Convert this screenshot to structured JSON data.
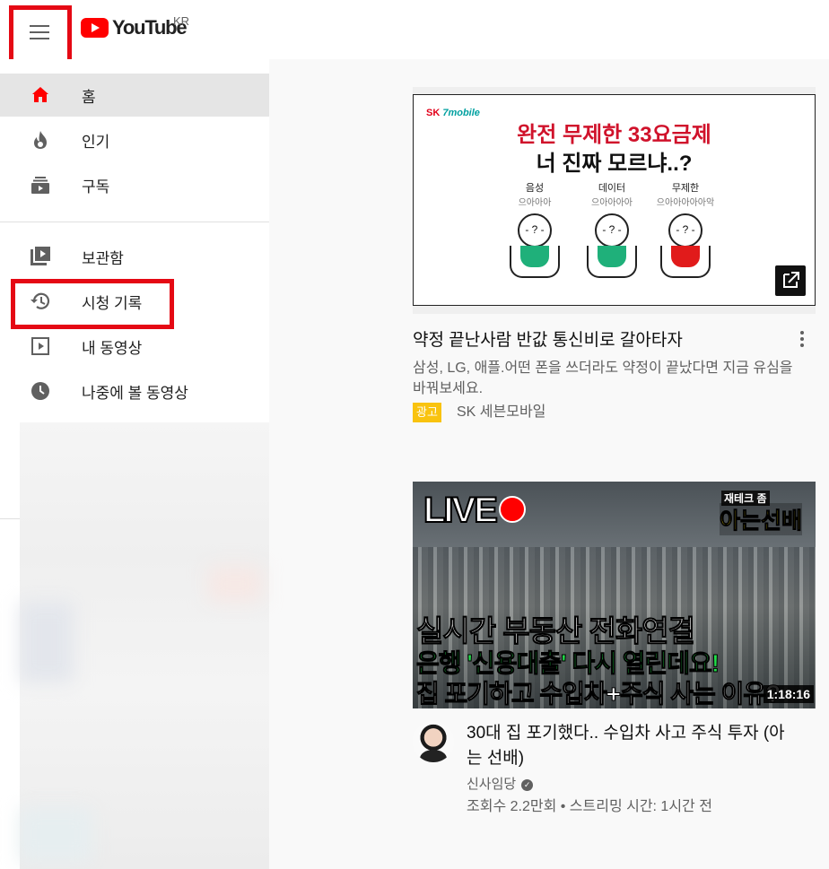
{
  "header": {
    "logo_text": "YouTube",
    "region": "KR"
  },
  "sidebar": {
    "items": [
      {
        "label": "홈",
        "icon": "home-icon",
        "active": true
      },
      {
        "label": "인기",
        "icon": "fire-icon"
      },
      {
        "label": "구독",
        "icon": "subscriptions-icon"
      },
      {
        "label": "보관함",
        "icon": "library-icon"
      },
      {
        "label": "시청 기록",
        "icon": "history-icon"
      },
      {
        "label": "내 동영상",
        "icon": "my-videos-icon"
      },
      {
        "label": "나중에 볼 동영상",
        "icon": "watch-later-icon"
      }
    ]
  },
  "ad": {
    "thumb_brand": "SK",
    "thumb_brand_sub": "7mobile",
    "thumb_headline": "완전 무제한 33요금제",
    "thumb_subheadline": "너 진짜 모르냐..?",
    "figures": [
      {
        "top": "음성",
        "sub": "으아아아",
        "color": "#1fb07a"
      },
      {
        "top": "데이터",
        "sub": "으아아아아",
        "color": "#1fb07a"
      },
      {
        "top": "무제한",
        "sub": "으아아아아아악",
        "color": "#e11b1b"
      }
    ],
    "title": "약정 끝난사람 반값 통신비로 갈아타자",
    "description": "삼성, LG, 애플.어떤 폰을 쓰더라도 약정이 끝났다면 지금 유심을 바꿔보세요.",
    "badge": "광고",
    "advertiser": "SK 세븐모바일"
  },
  "video": {
    "thumb_live": "LIVE",
    "thumb_channel_small": "재테크 좀",
    "thumb_channel_large": "아는선배",
    "thumb_line1": "실시간 부동산 전화연결",
    "thumb_line2": "은행 '신용대출' 다시 열린데요!",
    "thumb_line3": "집 포기하고 수입차+주식 사는 이유?",
    "duration": "1:18:16",
    "title": "30대 집 포기했다.. 수입차 사고 주식 투자 (아는 선배)",
    "channel": "신사임당",
    "meta": "조회수 2.2만회 • 스트리밍 시간: 1시간 전"
  },
  "colors": {
    "brand_red": "#ff0000",
    "highlight_box": "#e50914",
    "ad_badge": "#f9c30f"
  }
}
